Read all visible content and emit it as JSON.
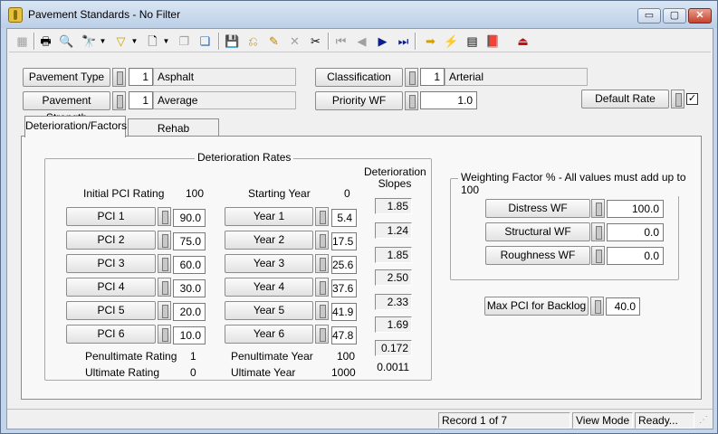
{
  "window": {
    "title": "Pavement Standards - No Filter"
  },
  "title_buttons": {
    "minimize": "▭",
    "maximize": "▢",
    "close": "✕"
  },
  "header": {
    "pavement_type_label": "Pavement Type",
    "pavement_type_num": "1",
    "pavement_type_value": "Asphalt",
    "pavement_strength_label": "Pavement Strength",
    "pavement_strength_num": "1",
    "pavement_strength_value": "Average",
    "classification_label": "Classification",
    "classification_num": "1",
    "classification_value": "Arterial",
    "priority_wf_label": "Priority WF",
    "priority_wf_value": "1.0",
    "default_rate_label": "Default Rate",
    "default_rate_checked": "✓"
  },
  "tabs": {
    "deterioration": "Deterioration/Factors",
    "rehab": "Rehab Techniques"
  },
  "deterioration": {
    "group_title": "Deterioration Rates",
    "initial_pci_label": "Initial PCI Rating",
    "initial_pci_value": "100",
    "starting_year_label": "Starting Year",
    "starting_year_value": "0",
    "slopes_header": "Deterioration\nSlopes",
    "pci_rows": [
      {
        "label": "PCI 1",
        "value": "90.0"
      },
      {
        "label": "PCI 2",
        "value": "75.0"
      },
      {
        "label": "PCI 3",
        "value": "60.0"
      },
      {
        "label": "PCI 4",
        "value": "30.0"
      },
      {
        "label": "PCI 5",
        "value": "20.0"
      },
      {
        "label": "PCI 6",
        "value": "10.0"
      }
    ],
    "year_rows": [
      {
        "label": "Year 1",
        "value": "5.4"
      },
      {
        "label": "Year 2",
        "value": "17.5"
      },
      {
        "label": "Year 3",
        "value": "25.6"
      },
      {
        "label": "Year 4",
        "value": "37.6"
      },
      {
        "label": "Year 5",
        "value": "41.9"
      },
      {
        "label": "Year 6",
        "value": "47.8"
      }
    ],
    "slopes": [
      "1.85",
      "1.24",
      "1.85",
      "2.50",
      "2.33",
      "1.69",
      "0.172"
    ],
    "slope_last": "0.0011",
    "penultimate_rating_label": "Penultimate Rating",
    "penultimate_rating_value": "1",
    "ultimate_rating_label": "Ultimate Rating",
    "ultimate_rating_value": "0",
    "penultimate_year_label": "Penultimate Year",
    "penultimate_year_value": "100",
    "ultimate_year_label": "Ultimate Year",
    "ultimate_year_value": "1000"
  },
  "weighting": {
    "group_title": "Weighting Factor % - All values must add up to 100",
    "rows": [
      {
        "label": "Distress WF",
        "value": "100.0"
      },
      {
        "label": "Structural WF",
        "value": "0.0"
      },
      {
        "label": "Roughness WF",
        "value": "0.0"
      }
    ]
  },
  "max_pci": {
    "label": "Max PCI for Backlog",
    "value": "40.0"
  },
  "status": {
    "record": "Record 1 of 7",
    "mode": "View Mode",
    "state": "Ready..."
  },
  "toolbar_icons": [
    "grid-icon",
    "print-icon",
    "print-preview-icon",
    "find-icon",
    "filter-icon",
    "new-record-icon",
    "copy-disabled-icon",
    "paste-icon",
    "save-disabled-icon",
    "undo-icon",
    "edit-icon",
    "delete-disabled-icon",
    "cut-icon",
    "first-record-icon",
    "previous-record-icon",
    "next-record-icon",
    "last-record-icon",
    "go-to-icon",
    "lightning-icon",
    "report-icon",
    "book-icon",
    "exit-icon"
  ]
}
